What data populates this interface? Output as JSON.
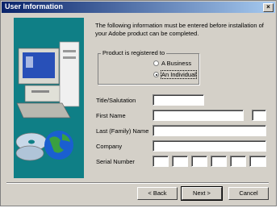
{
  "window": {
    "title": "User Information"
  },
  "intro": "The following information must be entered before installation of your Adobe product can be completed.",
  "registration": {
    "legend": "Product is registered to",
    "options": [
      {
        "label": "A Business",
        "selected": false
      },
      {
        "label": "An Individual",
        "selected": true
      }
    ]
  },
  "fields": {
    "title": {
      "label": "Title/Salutation",
      "value": ""
    },
    "first_name": {
      "label": "First Name",
      "value": "",
      "initial": ""
    },
    "last_name": {
      "label": "Last (Family) Name",
      "value": ""
    },
    "company": {
      "label": "Company",
      "value": ""
    },
    "serial": {
      "label": "Serial Number",
      "segments": [
        "",
        "",
        "",
        "",
        "",
        ""
      ]
    }
  },
  "buttons": {
    "back": "< Back",
    "next": "Next >",
    "cancel": "Cancel"
  },
  "colors": {
    "title_start": "#0a246a",
    "title_end": "#a6caf0",
    "illustration_bg": "#0f7f86",
    "dialog_bg": "#d4d0c8"
  },
  "icons": [
    "close-icon",
    "computer-icon",
    "cd-icon",
    "globe-icon"
  ]
}
